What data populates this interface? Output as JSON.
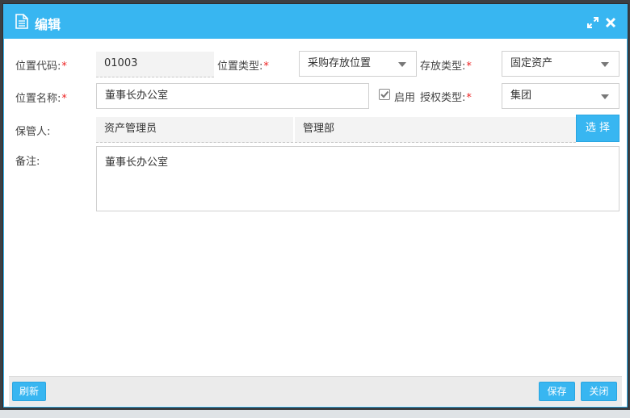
{
  "window": {
    "title": "编辑"
  },
  "form": {
    "location_code": {
      "label": "位置代码:",
      "required": "*",
      "value": "01003"
    },
    "location_type": {
      "label": "位置类型:",
      "required": "*",
      "value": "采购存放位置"
    },
    "storage_type": {
      "label": "存放类型:",
      "required": "*",
      "value": "固定资产"
    },
    "location_name": {
      "label": "位置名称:",
      "required": "*",
      "value": "董事长办公室"
    },
    "enabled": {
      "label": "启用",
      "checked": true
    },
    "auth_type": {
      "label": "授权类型:",
      "required": "*",
      "value": "集团"
    },
    "custodian": {
      "label": "保管人:",
      "person": "资产管理员",
      "department": "管理部",
      "select_label": "选 择"
    },
    "remarks": {
      "label": "备注:",
      "value": "董事长办公室"
    }
  },
  "footer": {
    "refresh_label": "刷新",
    "save_label": "保存",
    "close_label": "关闭"
  },
  "colors": {
    "accent": "#38b6f1",
    "required": "#e22222"
  }
}
